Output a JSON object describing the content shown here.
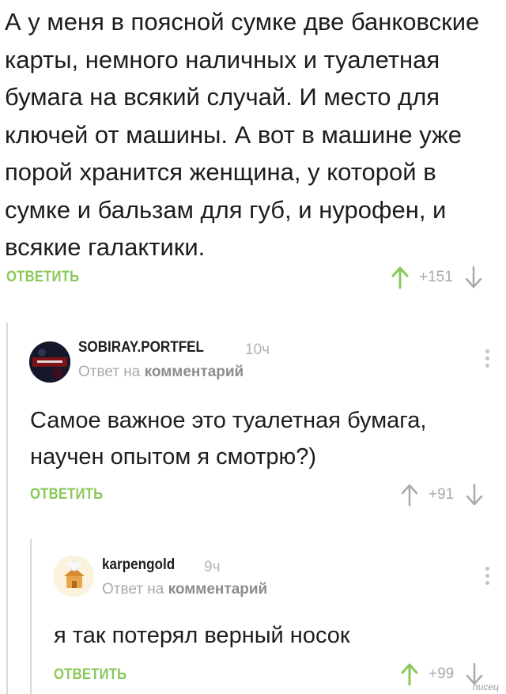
{
  "comments": [
    {
      "text": "А у меня в поясной сумке две банковские карты, немного наличных и туалетная бумага на всякий случай. И место для ключей от машины. А вот в машине уже порой хранится женщина, у которой в сумке и бальзам для губ, и нурофен, и всякие галактики.",
      "reply_label": "ОТВЕТИТЬ",
      "score": "+151",
      "upvoted": true
    },
    {
      "author": "SOBIRAY.PORTFEL",
      "time": "10ч",
      "reply_to_prefix": "Ответ на",
      "reply_to_link": "комментарий",
      "text": "Самое важное это туалетная бумага, научен опытом я смотрю?)",
      "reply_label": "ОТВЕТИТЬ",
      "score": "+91",
      "upvoted": false
    },
    {
      "author": "karpengold",
      "time": "9ч",
      "reply_to_prefix": "Ответ на",
      "reply_to_link": "комментарий",
      "text": "я так потерял верный носок",
      "reply_label": "ОТВЕТИТЬ",
      "score": "+99",
      "upvoted": true
    }
  ],
  "watermark": "писец",
  "colors": {
    "accent_green": "#8ac858",
    "muted_gray": "#a9a9a9",
    "thread_line": "#d8d8d8"
  },
  "icons": [
    "upvote-arrow-icon",
    "downvote-arrow-icon",
    "more-options-icon",
    "avatar"
  ]
}
